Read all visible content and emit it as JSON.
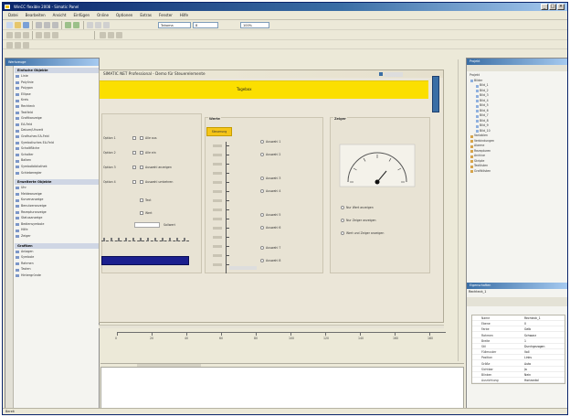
{
  "window": {
    "title": "WinCC flexible 2008 - Simatic Panel"
  },
  "menu": [
    "Datei",
    "Bearbeiten",
    "Ansicht",
    "Einfügen",
    "Online",
    "Optionen",
    "Extras",
    "Fenster",
    "Hilfe"
  ],
  "toolbar": {
    "font_combo": "Tahoma",
    "size_combo": "8",
    "zoom_combo": "100%"
  },
  "left_toolbox": {
    "title": "Werkzeuge",
    "groups": [
      {
        "header": "Einfache Objekte",
        "items": [
          "Linie",
          "Polylinie",
          "Polygon",
          "Ellipse",
          "Kreis",
          "Rechteck",
          "Textfeld",
          "Grafikanzeige",
          "EA-Feld",
          "Datum/Uhrzeit",
          "Grafisches EA-Feld",
          "Symbolisches EA-Feld",
          "Schaltfläche",
          "Schalter",
          "Balken",
          "Symbolbibliothek",
          "Schieberegler"
        ]
      },
      {
        "header": "Erweiterte Objekte",
        "items": [
          "Uhr",
          "Meldeanzeige",
          "Kurvenanzeige",
          "Benutzeranzeige",
          "Rezepturanzeige",
          "Statusanzeige",
          "Bediensymbole",
          "Hilfe",
          "Zeiger"
        ]
      },
      {
        "header": "Grafiken",
        "items": [
          "Anlagen",
          "Symbole",
          "Rahmen",
          "Tasten",
          "Hintergründe"
        ]
      }
    ]
  },
  "screen": {
    "title": "SIMATIC NET Professional - Demo für Steuerelemente",
    "header_label": "Tagebox",
    "group_left_title": "",
    "group_mid_title": "Werte",
    "group_right_title": "Zeiger",
    "button_label": "Steuerung",
    "left_checks": [
      "Option 1",
      "Option 2",
      "Option 3",
      "Option 4"
    ],
    "right_checks": [
      "Alle aus",
      "Alle ein",
      "Auswahl anzeigen",
      "Auswahl umkehren"
    ],
    "mid_radios": [
      "Auswahl 1",
      "Auswahl 2",
      "Auswahl 3",
      "Auswahl 4",
      "Auswahl 5",
      "Auswahl 6",
      "Auswahl 7",
      "Auswahl 8"
    ],
    "gauge_options": [
      "Nur Wert anzeigen",
      "Nur Zeiger anzeigen",
      "Wert und Zeiger anzeigen"
    ],
    "small_labels": [
      "Text",
      "Wert"
    ],
    "field_label": "Sollwert",
    "slider_value": 0.7
  },
  "ruler": {
    "ticks": [
      "0",
      "20",
      "40",
      "60",
      "80",
      "100",
      "120",
      "140",
      "160",
      "180"
    ]
  },
  "right_panel": {
    "title": "Projekt",
    "tree": [
      "Projekt",
      "Bilder",
      "Bild_1",
      "Bild_2",
      "Bild_3",
      "Bild_4",
      "Bild_5",
      "Bild_6",
      "Bild_7",
      "Bild_8",
      "Bild_9",
      "Bild_10",
      "Variablen",
      "Verbindungen",
      "Alarme",
      "Rezepturen",
      "Archive",
      "Skripte",
      "Textlisten",
      "Grafiklisten"
    ],
    "properties_title": "Eigenschaften",
    "properties_subtitle": "Rechteck_1",
    "props": [
      {
        "name": "Name",
        "value": "Rechteck_1"
      },
      {
        "name": "Ebene",
        "value": "0"
      },
      {
        "name": "Farbe",
        "value": "Gelb"
      },
      {
        "name": "Rahmen",
        "value": "Schwarz"
      },
      {
        "name": "Breite",
        "value": "1"
      },
      {
        "name": "Stil",
        "value": "Durchgezogen"
      },
      {
        "name": "Füllmuster",
        "value": "Voll"
      },
      {
        "name": "Position",
        "value": "Links"
      },
      {
        "name": "Größe",
        "value": "Auto"
      },
      {
        "name": "Sichtbar",
        "value": "Ja"
      },
      {
        "name": "Blinken",
        "value": "Nein"
      },
      {
        "name": "Ausrichtung",
        "value": "Horizontal"
      }
    ]
  },
  "status": {
    "text": "Bereit"
  }
}
